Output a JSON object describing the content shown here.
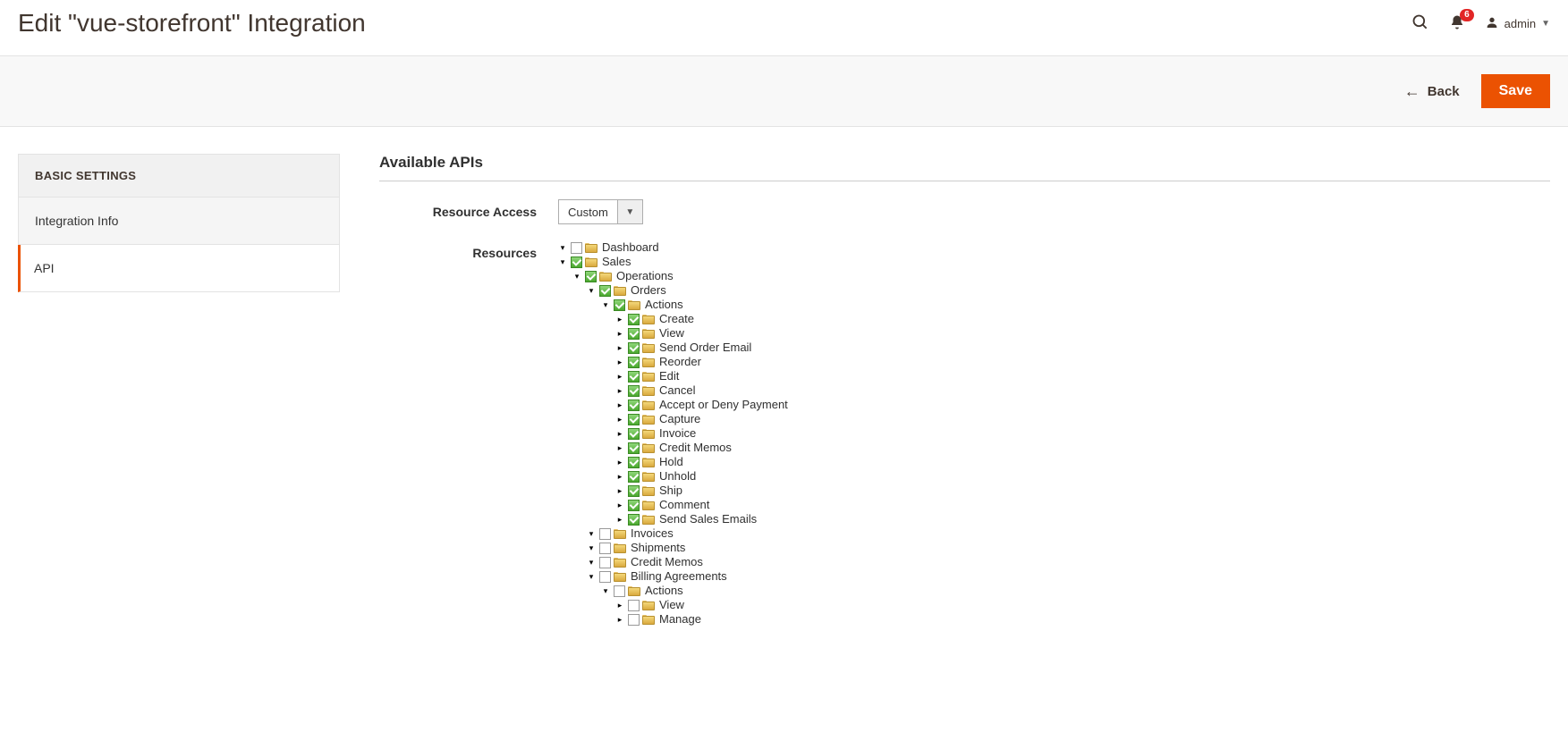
{
  "header": {
    "page_title": "Edit \"vue-storefront\" Integration",
    "notifications_count": "6",
    "username": "admin"
  },
  "actions": {
    "back_label": "Back",
    "save_label": "Save"
  },
  "sidebar": {
    "heading": "BASIC SETTINGS",
    "items": [
      {
        "label": "Integration Info",
        "active": false
      },
      {
        "label": "API",
        "active": true
      }
    ]
  },
  "main": {
    "section_title": "Available APIs",
    "resource_access_label": "Resource Access",
    "resource_access_value": "Custom",
    "resources_label": "Resources"
  },
  "tree": [
    {
      "label": "Dashboard",
      "checked": false,
      "state": "expanded",
      "children": []
    },
    {
      "label": "Sales",
      "checked": true,
      "state": "expanded",
      "children": [
        {
          "label": "Operations",
          "checked": true,
          "state": "expanded",
          "children": [
            {
              "label": "Orders",
              "checked": true,
              "state": "expanded",
              "children": [
                {
                  "label": "Actions",
                  "checked": true,
                  "state": "expanded",
                  "children": [
                    {
                      "label": "Create",
                      "checked": true,
                      "state": "leaf",
                      "children": []
                    },
                    {
                      "label": "View",
                      "checked": true,
                      "state": "leaf",
                      "children": []
                    },
                    {
                      "label": "Send Order Email",
                      "checked": true,
                      "state": "leaf",
                      "children": []
                    },
                    {
                      "label": "Reorder",
                      "checked": true,
                      "state": "leaf",
                      "children": []
                    },
                    {
                      "label": "Edit",
                      "checked": true,
                      "state": "leaf",
                      "children": []
                    },
                    {
                      "label": "Cancel",
                      "checked": true,
                      "state": "leaf",
                      "children": []
                    },
                    {
                      "label": "Accept or Deny Payment",
                      "checked": true,
                      "state": "leaf",
                      "children": []
                    },
                    {
                      "label": "Capture",
                      "checked": true,
                      "state": "leaf",
                      "children": []
                    },
                    {
                      "label": "Invoice",
                      "checked": true,
                      "state": "leaf",
                      "children": []
                    },
                    {
                      "label": "Credit Memos",
                      "checked": true,
                      "state": "leaf",
                      "children": []
                    },
                    {
                      "label": "Hold",
                      "checked": true,
                      "state": "leaf",
                      "children": []
                    },
                    {
                      "label": "Unhold",
                      "checked": true,
                      "state": "leaf",
                      "children": []
                    },
                    {
                      "label": "Ship",
                      "checked": true,
                      "state": "leaf",
                      "children": []
                    },
                    {
                      "label": "Comment",
                      "checked": true,
                      "state": "leaf",
                      "children": []
                    },
                    {
                      "label": "Send Sales Emails",
                      "checked": true,
                      "state": "leaf",
                      "children": []
                    }
                  ]
                }
              ]
            },
            {
              "label": "Invoices",
              "checked": false,
              "state": "expanded",
              "children": []
            },
            {
              "label": "Shipments",
              "checked": false,
              "state": "expanded",
              "children": []
            },
            {
              "label": "Credit Memos",
              "checked": false,
              "state": "expanded",
              "children": []
            },
            {
              "label": "Billing Agreements",
              "checked": false,
              "state": "expanded",
              "children": [
                {
                  "label": "Actions",
                  "checked": false,
                  "state": "expanded",
                  "children": [
                    {
                      "label": "View",
                      "checked": false,
                      "state": "leaf",
                      "children": []
                    },
                    {
                      "label": "Manage",
                      "checked": false,
                      "state": "leaf",
                      "children": []
                    }
                  ]
                }
              ]
            }
          ]
        }
      ]
    }
  ]
}
